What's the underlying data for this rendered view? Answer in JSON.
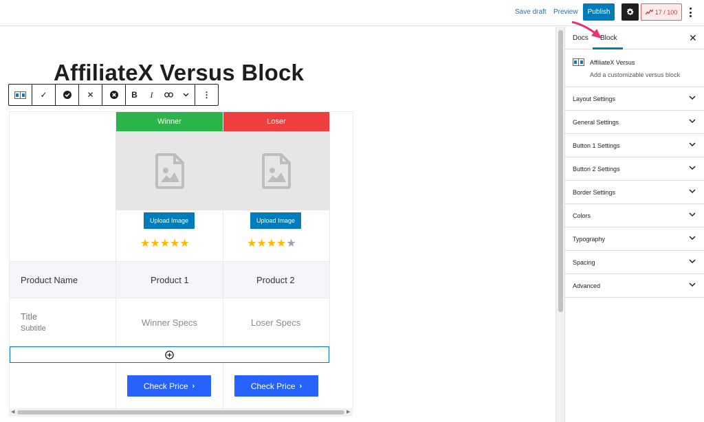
{
  "topbar": {
    "save_draft": "Save draft",
    "preview": "Preview",
    "publish": "Publish",
    "score": "17 / 100"
  },
  "editor": {
    "post_title": "AffiliateX Versus Block"
  },
  "versus_table": {
    "columns": [
      {
        "header": "Winner",
        "header_color": "#2bb44a",
        "upload_label": "Upload Image",
        "rating": 5,
        "name": "Product 1",
        "spec": "Winner Specs",
        "button": "Check Price"
      },
      {
        "header": "Loser",
        "header_color": "#ef3e3e",
        "upload_label": "Upload Image",
        "rating": 4,
        "name": "Product 2",
        "spec": "Loser Specs",
        "button": "Check Price"
      }
    ],
    "row_label_name": "Product Name",
    "row_label_title": "Title",
    "row_label_subtitle": "Subtitle"
  },
  "sidebar": {
    "tab_docs": "Docs",
    "tab_block": "Block",
    "block_name": "AffiliateX Versus",
    "block_desc": "Add a customizable versus block",
    "panels": [
      "Layout Settings",
      "General Settings",
      "Button 1 Settings",
      "Button 2 Settings",
      "Border Settings",
      "Colors",
      "Typography",
      "Spacing",
      "Advanced"
    ]
  },
  "colors": {
    "accent": "#007cba",
    "button_blue": "#2762ff",
    "winner_green": "#2bb44a",
    "loser_red": "#ef3e3e",
    "star": "#ffb900",
    "arrow_pink": "#e8336f"
  }
}
